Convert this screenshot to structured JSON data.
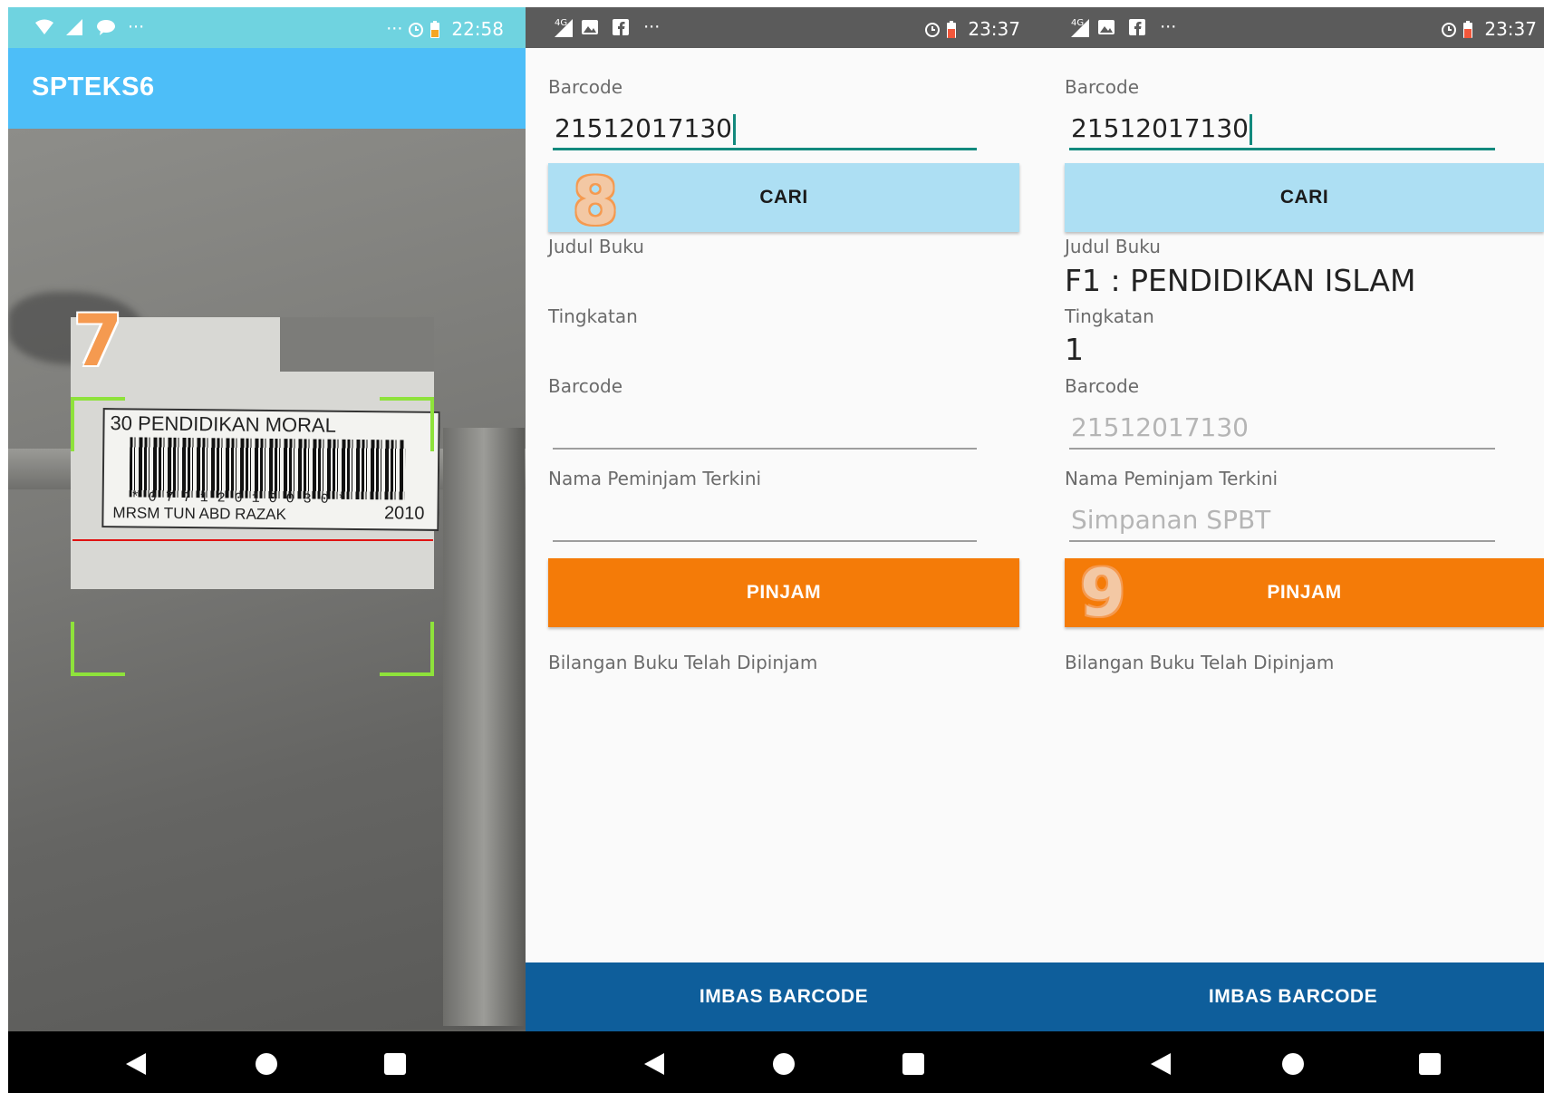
{
  "panel1": {
    "status": {
      "time": "22:58",
      "left_more": "···",
      "right_more": "···"
    },
    "app_title": "SPTEKS6",
    "scanned_label": {
      "title": "30  PENDIDIKAN MORAL",
      "number": "*07712010030*",
      "school": "MRSM TUN ABD RAZAK",
      "year": "2010"
    },
    "annotation": "7"
  },
  "panel2": {
    "status": {
      "time": "23:37",
      "network": "4G",
      "more": "···"
    },
    "barcode_label": "Barcode",
    "barcode_value": "21512017130",
    "search_button": "CARI",
    "judul_label": "Judul Buku",
    "judul_value": "",
    "tingkatan_label": "Tingkatan",
    "tingkatan_value": "",
    "barcode2_label": "Barcode",
    "barcode2_value": "",
    "peminjam_label": "Nama Peminjam Terkini",
    "peminjam_value": "",
    "borrow_button": "PINJAM",
    "count_label": "Bilangan Buku Telah Dipinjam",
    "scan_button": "IMBAS BARCODE",
    "annotation": "8"
  },
  "panel3": {
    "status": {
      "time": "23:37",
      "network": "4G",
      "more": "···"
    },
    "barcode_label": "Barcode",
    "barcode_value": "21512017130",
    "search_button": "CARI",
    "judul_label": "Judul Buku",
    "judul_value": "F1 : PENDIDIKAN ISLAM",
    "tingkatan_label": "Tingkatan",
    "tingkatan_value": "1",
    "barcode2_label": "Barcode",
    "barcode2_value": "21512017130",
    "peminjam_label": "Nama Peminjam Terkini",
    "peminjam_value": "Simpanan SPBT",
    "borrow_button": "PINJAM",
    "count_label": "Bilangan Buku Telah Dipinjam",
    "scan_button": "IMBAS BARCODE",
    "annotation": "9"
  },
  "colors": {
    "app_bar": "#4dbef8",
    "accent": "#12897d",
    "cari_button": "#addff3",
    "pinjam_button": "#f47b08",
    "imbas_button": "#0e5e9b",
    "scan_frame": "#8ee23b",
    "scan_line": "#e01212",
    "annotation": "#f59a50"
  },
  "icons": [
    "wifi-icon",
    "signal-icon",
    "image-icon",
    "facebook-icon",
    "alarm-icon",
    "battery-icon",
    "back-icon",
    "home-icon",
    "recent-apps-icon"
  ]
}
